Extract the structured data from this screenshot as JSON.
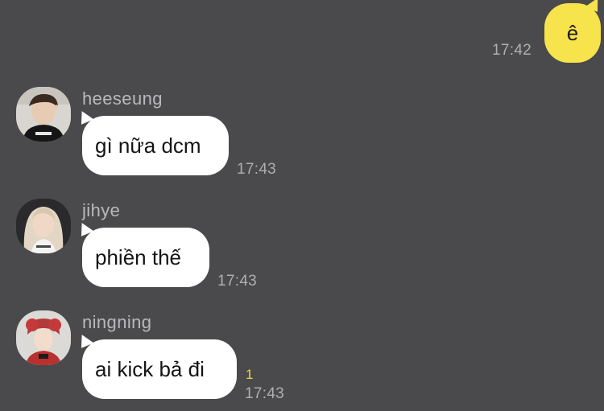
{
  "theme": {
    "background": "#4a4a4c",
    "outgoing_bubble": "#f7e34b",
    "incoming_bubble": "#ffffff",
    "timestamp_color": "#aeaeb2",
    "unread_color": "#f2d43a"
  },
  "outgoing": {
    "text": "ê",
    "time": "17:42"
  },
  "messages": [
    {
      "sender": "heeseung",
      "text": "gì nữa dcm",
      "time": "17:43",
      "avatar_icon": "user-avatar-icon"
    },
    {
      "sender": "jihye",
      "text": "phiền thế",
      "time": "17:43",
      "avatar_icon": "user-avatar-icon"
    },
    {
      "sender": "ningning",
      "text": "ai kick bả đi",
      "time": "17:43",
      "unread": "1",
      "avatar_icon": "user-avatar-icon"
    }
  ]
}
